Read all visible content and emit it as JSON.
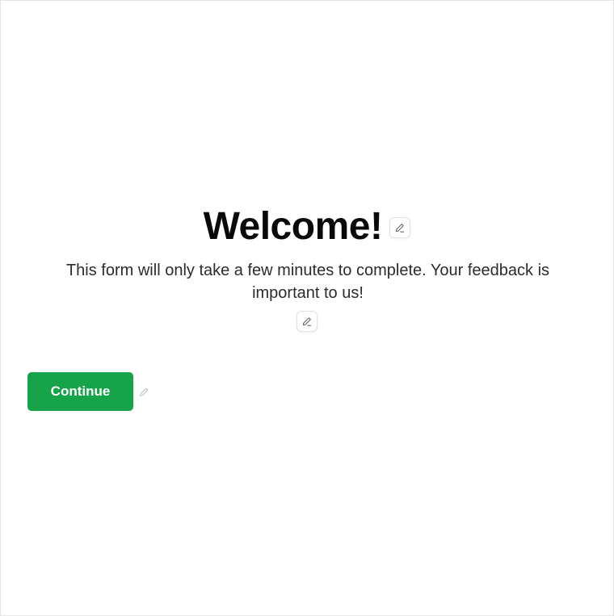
{
  "welcome": {
    "title": "Welcome!",
    "description": "This form will only take a few minutes to complete. Your feedback is important to us!",
    "continue_label": "Continue"
  },
  "icons": {
    "title_edit": "pencil-icon",
    "description_edit": "pencil-icon",
    "button_edit": "pencil-icon"
  },
  "colors": {
    "accent": "#17a34a",
    "title_text": "#0a0a0a",
    "body_text": "#2b2b2b",
    "frame_border": "#e3e3e3"
  }
}
